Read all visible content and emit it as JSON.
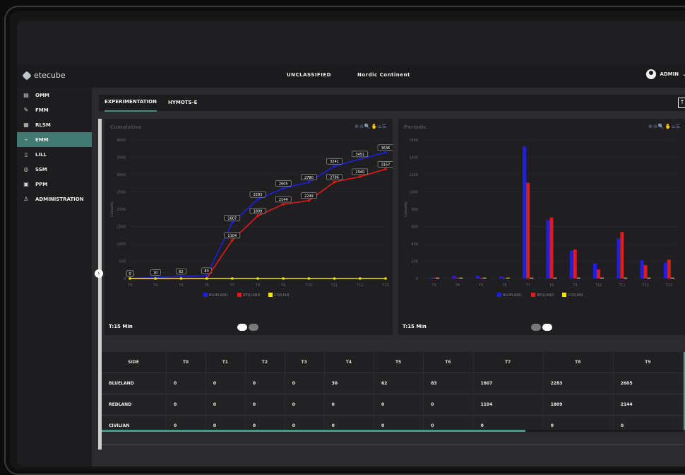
{
  "header": {
    "brand": "etecube",
    "classification": "UNCLASSIFIED",
    "region": "Nordic Continent",
    "user": "ADMIN"
  },
  "sidebar": {
    "items": [
      {
        "label": "OMM",
        "icon": "document-icon"
      },
      {
        "label": "FMM",
        "icon": "edit-icon"
      },
      {
        "label": "RLSM",
        "icon": "grid-icon"
      },
      {
        "label": "EMM",
        "icon": "chart-icon"
      },
      {
        "label": "LILL",
        "icon": "file-icon"
      },
      {
        "label": "SSM",
        "icon": "globe-icon"
      },
      {
        "label": "PPM",
        "icon": "calendar-icon"
      },
      {
        "label": "ADMINISTRATION",
        "icon": "users-icon"
      }
    ],
    "active": "EMM"
  },
  "tabs": [
    {
      "label": "EXPERIMENTATION"
    },
    {
      "label": "HYMOTS-E"
    }
  ],
  "panels": {
    "left": {
      "title": "Cumulative",
      "footer": "T:15 Min",
      "ylabel": "Casualty"
    },
    "right": {
      "title": "Periodic",
      "footer": "T:15 Min",
      "ylabel": "Casualty"
    }
  },
  "colors": {
    "blueland": "#1f1fe0",
    "redland": "#e01a1a",
    "civilian": "#f2e600",
    "accent": "#41786f"
  },
  "chart_data": [
    {
      "type": "line",
      "title": "Cumulative",
      "xlabel": "",
      "ylabel": "Casualty",
      "ylim": [
        0,
        4000
      ],
      "yticks": [
        "0",
        "500",
        "1000",
        "1500",
        "2000",
        "2500",
        "3000",
        "3500",
        "4000"
      ],
      "categories": [
        "T3",
        "T4",
        "T5",
        "T6",
        "T7",
        "T8",
        "T9",
        "T10",
        "T11",
        "T12",
        "T13"
      ],
      "series": [
        {
          "name": "BLUELAND",
          "values": [
            0,
            30,
            62,
            83,
            1607,
            2283,
            2605,
            2780,
            3241,
            3451,
            3636
          ]
        },
        {
          "name": "REDLAND",
          "values": [
            0,
            0,
            0,
            0,
            1104,
            1809,
            2144,
            2249,
            2786,
            2940,
            3157
          ]
        },
        {
          "name": "CIVILIAN",
          "values": [
            0,
            0,
            0,
            0,
            0,
            0,
            0,
            0,
            0,
            0,
            0
          ]
        }
      ],
      "legend": "bottom"
    },
    {
      "type": "bar",
      "title": "Periodic",
      "xlabel": "",
      "ylabel": "Casualty",
      "ylim": [
        0,
        1600
      ],
      "yticks": [
        "0",
        "200",
        "400",
        "600",
        "800",
        "1000",
        "1200",
        "1400",
        "1600"
      ],
      "categories": [
        "T3",
        "T4",
        "T5",
        "T6",
        "T7",
        "T8",
        "T9",
        "T10",
        "T11",
        "T12",
        "T13"
      ],
      "series": [
        {
          "name": "BLUELAND",
          "values": [
            0,
            30,
            32,
            21,
            1524,
            676,
            322,
            175,
            461,
            210,
            185
          ]
        },
        {
          "name": "REDLAND",
          "values": [
            0,
            0,
            0,
            0,
            1104,
            705,
            335,
            105,
            537,
            154,
            217
          ]
        },
        {
          "name": "CIVILIAN",
          "values": [
            0,
            0,
            0,
            0,
            0,
            0,
            0,
            0,
            0,
            0,
            0
          ]
        }
      ],
      "legend": "bottom"
    }
  ],
  "table": {
    "columns": [
      "SIDE",
      "T0",
      "T1",
      "T2",
      "T3",
      "T4",
      "T5",
      "T6",
      "T7",
      "T8",
      "T9"
    ],
    "rows": [
      {
        "side": "BLUELAND",
        "values": [
          "0",
          "0",
          "0",
          "0",
          "30",
          "62",
          "83",
          "1607",
          "2283",
          "2605"
        ]
      },
      {
        "side": "REDLAND",
        "values": [
          "0",
          "0",
          "0",
          "0",
          "0",
          "0",
          "0",
          "1104",
          "1809",
          "2144"
        ]
      },
      {
        "side": "CIVILIAN",
        "values": [
          "0",
          "0",
          "0",
          "0",
          "0",
          "0",
          "0",
          "0",
          "0",
          "0"
        ]
      }
    ]
  }
}
